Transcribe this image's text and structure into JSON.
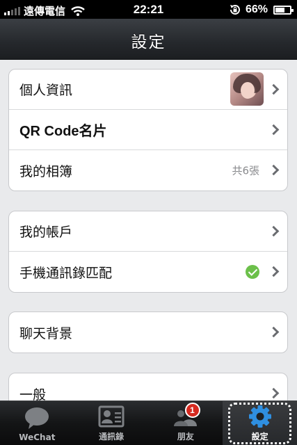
{
  "status_bar": {
    "carrier": "遠傳電信",
    "time": "22:21",
    "battery_percent": "66%",
    "battery_level": 0.66,
    "icons": [
      "signal-icon",
      "wifi-icon",
      "rotation-lock-icon",
      "battery-icon"
    ]
  },
  "nav": {
    "title": "設定"
  },
  "groups": [
    {
      "rows": [
        {
          "label": "個人資訊",
          "accessory": "avatar"
        },
        {
          "label": "QR Code名片",
          "accessory": "none"
        },
        {
          "label": "我的相簿",
          "value": "共6張"
        }
      ]
    },
    {
      "rows": [
        {
          "label": "我的帳戶",
          "accessory": "none"
        },
        {
          "label": "手機通訊錄匹配",
          "accessory": "check"
        }
      ]
    },
    {
      "rows": [
        {
          "label": "聊天背景",
          "accessory": "none"
        }
      ]
    },
    {
      "rows": [
        {
          "label": "一般",
          "accessory": "none"
        }
      ]
    }
  ],
  "tab_bar": {
    "tabs": [
      {
        "label": "WeChat",
        "icon": "chat-bubble-icon"
      },
      {
        "label": "通訊錄",
        "icon": "contact-card-icon"
      },
      {
        "label": "朋友",
        "icon": "friends-icon",
        "badge": "1"
      },
      {
        "label": "設定",
        "icon": "gear-icon",
        "active": true
      }
    ]
  },
  "colors": {
    "background": "#e9eaec",
    "nav_bar": "#25282c",
    "tab_active": "#2f8fe0",
    "badge": "#d62a20",
    "check": "#6cc04a"
  }
}
